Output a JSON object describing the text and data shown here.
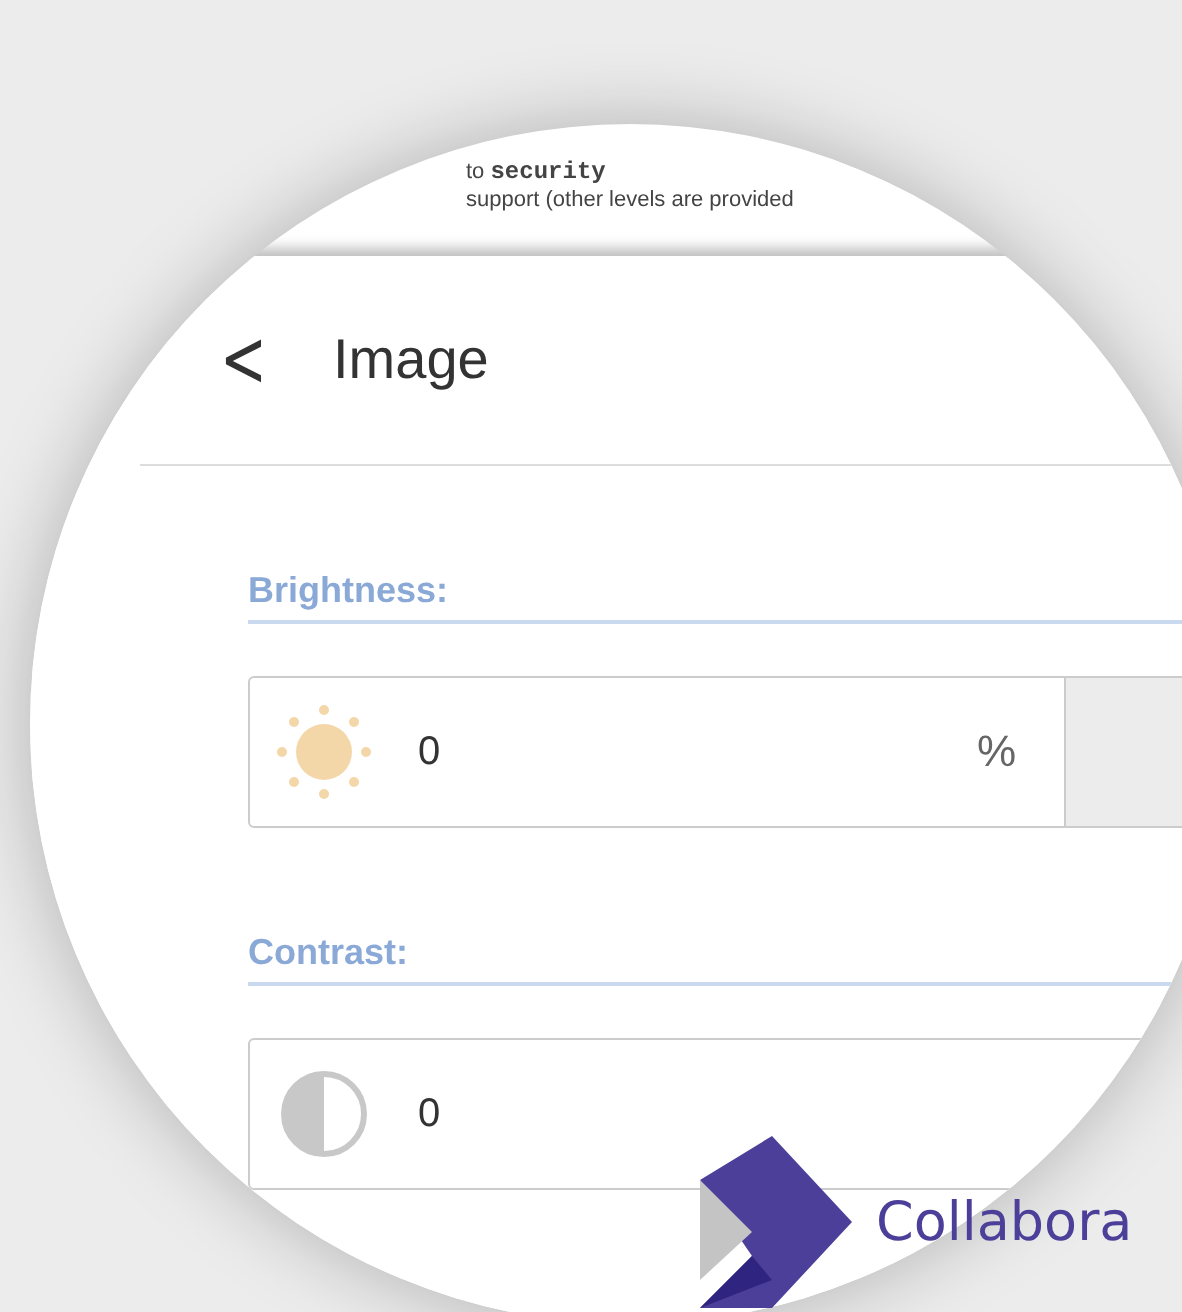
{
  "document_excerpt": {
    "lines": [
      "to **security**",
      "support (other levels are provided"
    ]
  },
  "header": {
    "back": "<",
    "title": "Image"
  },
  "settings": [
    {
      "kind": "brightness",
      "label": "Brightness:",
      "value": "0",
      "unit": "%"
    },
    {
      "kind": "contrast",
      "label": "Contrast:",
      "value": "0"
    }
  ],
  "brand": {
    "name": "Collabora"
  }
}
